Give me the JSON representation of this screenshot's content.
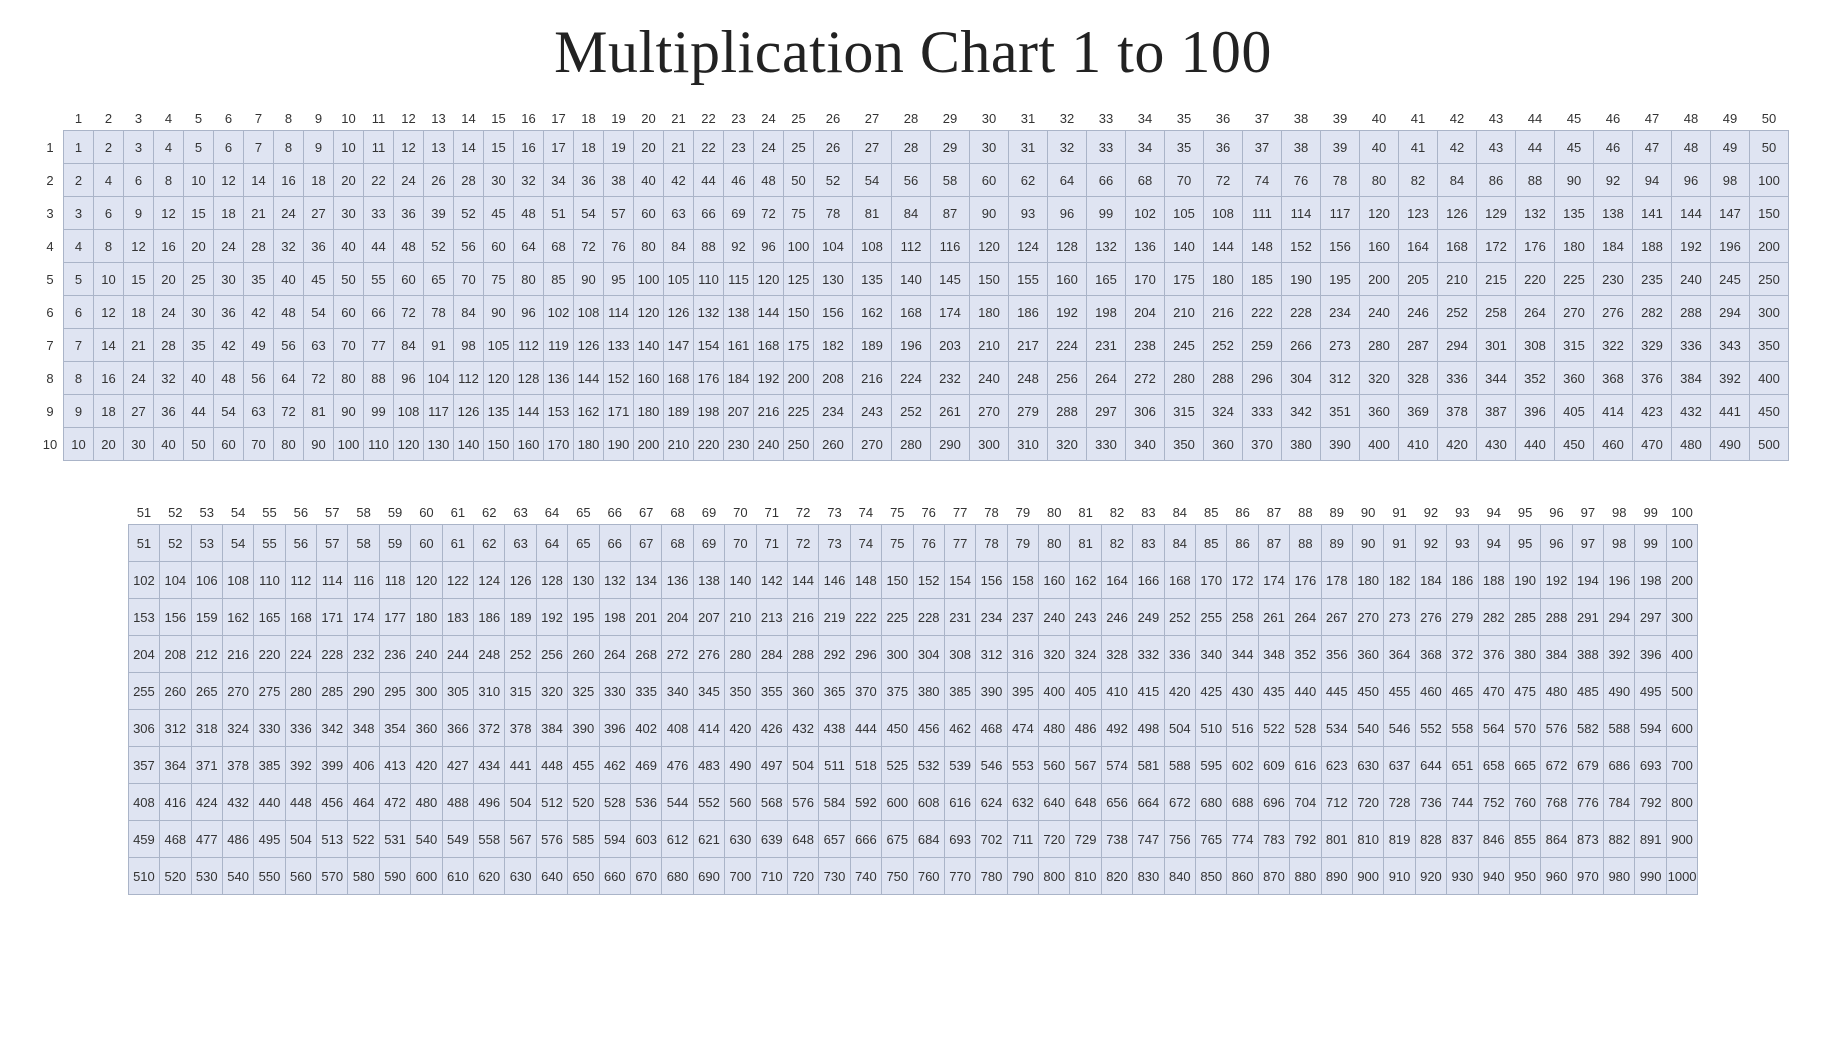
{
  "title": "Multiplication Chart 1 to 100",
  "chart_data": {
    "type": "table",
    "title": "Multiplication Chart 1 to 100",
    "description": "Two sub-tables showing products of rows 1–10 with columns 1–50 and 51–100.",
    "tables": [
      {
        "row_headers": [
          1,
          2,
          3,
          4,
          5,
          6,
          7,
          8,
          9,
          10
        ],
        "col_headers": [
          1,
          2,
          3,
          4,
          5,
          6,
          7,
          8,
          9,
          10,
          11,
          12,
          13,
          14,
          15,
          16,
          17,
          18,
          19,
          20,
          21,
          22,
          23,
          24,
          25,
          26,
          27,
          28,
          29,
          30,
          31,
          32,
          33,
          34,
          35,
          36,
          37,
          38,
          39,
          40,
          41,
          42,
          43,
          44,
          45,
          46,
          47,
          48,
          49,
          50
        ],
        "rows": [
          [
            1,
            2,
            3,
            4,
            5,
            6,
            7,
            8,
            9,
            10,
            11,
            12,
            13,
            14,
            15,
            16,
            17,
            18,
            19,
            20,
            21,
            22,
            23,
            24,
            25,
            26,
            27,
            28,
            29,
            30,
            31,
            32,
            33,
            34,
            35,
            36,
            37,
            38,
            39,
            40,
            41,
            42,
            43,
            44,
            45,
            46,
            47,
            48,
            49,
            50
          ],
          [
            2,
            4,
            6,
            8,
            10,
            12,
            14,
            16,
            18,
            20,
            22,
            24,
            26,
            28,
            30,
            32,
            34,
            36,
            38,
            40,
            42,
            44,
            46,
            48,
            50,
            52,
            54,
            56,
            58,
            60,
            62,
            64,
            66,
            68,
            70,
            72,
            74,
            76,
            78,
            80,
            82,
            84,
            86,
            88,
            90,
            92,
            94,
            96,
            98,
            100
          ],
          [
            3,
            6,
            9,
            12,
            15,
            18,
            21,
            24,
            27,
            30,
            33,
            36,
            39,
            52,
            45,
            48,
            51,
            54,
            57,
            60,
            63,
            66,
            69,
            72,
            75,
            78,
            81,
            84,
            87,
            90,
            93,
            96,
            99,
            102,
            105,
            108,
            111,
            114,
            117,
            120,
            123,
            126,
            129,
            132,
            135,
            138,
            141,
            144,
            147,
            150
          ],
          [
            4,
            8,
            12,
            16,
            20,
            24,
            28,
            32,
            36,
            40,
            44,
            48,
            52,
            56,
            60,
            64,
            68,
            72,
            76,
            80,
            84,
            88,
            92,
            96,
            100,
            104,
            108,
            112,
            116,
            120,
            124,
            128,
            132,
            136,
            140,
            144,
            148,
            152,
            156,
            160,
            164,
            168,
            172,
            176,
            180,
            184,
            188,
            192,
            196,
            200
          ],
          [
            5,
            10,
            15,
            20,
            25,
            30,
            35,
            40,
            45,
            50,
            55,
            60,
            65,
            70,
            75,
            80,
            85,
            90,
            95,
            100,
            105,
            110,
            115,
            120,
            125,
            130,
            135,
            140,
            145,
            150,
            155,
            160,
            165,
            170,
            175,
            180,
            185,
            190,
            195,
            200,
            205,
            210,
            215,
            220,
            225,
            230,
            235,
            240,
            245,
            250
          ],
          [
            6,
            12,
            18,
            24,
            30,
            36,
            42,
            48,
            54,
            60,
            66,
            72,
            78,
            84,
            90,
            96,
            102,
            108,
            114,
            120,
            126,
            132,
            138,
            144,
            150,
            156,
            162,
            168,
            174,
            180,
            186,
            192,
            198,
            204,
            210,
            216,
            222,
            228,
            234,
            240,
            246,
            252,
            258,
            264,
            270,
            276,
            282,
            288,
            294,
            300
          ],
          [
            7,
            14,
            21,
            28,
            35,
            42,
            49,
            56,
            63,
            70,
            77,
            84,
            91,
            98,
            105,
            112,
            119,
            126,
            133,
            140,
            147,
            154,
            161,
            168,
            175,
            182,
            189,
            196,
            203,
            210,
            217,
            224,
            231,
            238,
            245,
            252,
            259,
            266,
            273,
            280,
            287,
            294,
            301,
            308,
            315,
            322,
            329,
            336,
            343,
            350
          ],
          [
            8,
            16,
            24,
            32,
            40,
            48,
            56,
            64,
            72,
            80,
            88,
            96,
            104,
            112,
            120,
            128,
            136,
            144,
            152,
            160,
            168,
            176,
            184,
            192,
            200,
            208,
            216,
            224,
            232,
            240,
            248,
            256,
            264,
            272,
            280,
            288,
            296,
            304,
            312,
            320,
            328,
            336,
            344,
            352,
            360,
            368,
            376,
            384,
            392,
            400
          ],
          [
            9,
            18,
            27,
            36,
            44,
            54,
            63,
            72,
            81,
            90,
            99,
            108,
            117,
            126,
            135,
            144,
            153,
            162,
            171,
            180,
            189,
            198,
            207,
            216,
            225,
            234,
            243,
            252,
            261,
            270,
            279,
            288,
            297,
            306,
            315,
            324,
            333,
            342,
            351,
            360,
            369,
            378,
            387,
            396,
            405,
            414,
            423,
            432,
            441,
            450
          ],
          [
            10,
            20,
            30,
            40,
            50,
            60,
            70,
            80,
            90,
            100,
            110,
            120,
            130,
            140,
            150,
            160,
            170,
            180,
            190,
            200,
            210,
            220,
            230,
            240,
            250,
            260,
            270,
            280,
            290,
            300,
            310,
            320,
            330,
            340,
            350,
            360,
            370,
            380,
            390,
            400,
            410,
            420,
            430,
            440,
            450,
            460,
            470,
            480,
            490,
            500
          ]
        ]
      },
      {
        "col_headers": [
          51,
          52,
          53,
          54,
          55,
          56,
          57,
          58,
          59,
          60,
          61,
          62,
          63,
          64,
          65,
          66,
          67,
          68,
          69,
          70,
          71,
          72,
          73,
          74,
          75,
          76,
          77,
          78,
          79,
          80,
          81,
          82,
          83,
          84,
          85,
          86,
          87,
          88,
          89,
          90,
          91,
          92,
          93,
          94,
          95,
          96,
          97,
          98,
          99,
          100
        ],
        "rows": [
          [
            51,
            52,
            53,
            54,
            55,
            56,
            57,
            58,
            59,
            60,
            61,
            62,
            63,
            64,
            65,
            66,
            67,
            68,
            69,
            70,
            71,
            72,
            73,
            74,
            75,
            76,
            77,
            78,
            79,
            80,
            81,
            82,
            83,
            84,
            85,
            86,
            87,
            88,
            89,
            90,
            91,
            92,
            93,
            94,
            95,
            96,
            97,
            98,
            99,
            100
          ],
          [
            102,
            104,
            106,
            108,
            110,
            112,
            114,
            116,
            118,
            120,
            122,
            124,
            126,
            128,
            130,
            132,
            134,
            136,
            138,
            140,
            142,
            144,
            146,
            148,
            150,
            152,
            154,
            156,
            158,
            160,
            162,
            164,
            166,
            168,
            170,
            172,
            174,
            176,
            178,
            180,
            182,
            184,
            186,
            188,
            190,
            192,
            194,
            196,
            198,
            200
          ],
          [
            153,
            156,
            159,
            162,
            165,
            168,
            171,
            174,
            177,
            180,
            183,
            186,
            189,
            192,
            195,
            198,
            201,
            204,
            207,
            210,
            213,
            216,
            219,
            222,
            225,
            228,
            231,
            234,
            237,
            240,
            243,
            246,
            249,
            252,
            255,
            258,
            261,
            264,
            267,
            270,
            273,
            276,
            279,
            282,
            285,
            288,
            291,
            294,
            297,
            300
          ],
          [
            204,
            208,
            212,
            216,
            220,
            224,
            228,
            232,
            236,
            240,
            244,
            248,
            252,
            256,
            260,
            264,
            268,
            272,
            276,
            280,
            284,
            288,
            292,
            296,
            300,
            304,
            308,
            312,
            316,
            320,
            324,
            328,
            332,
            336,
            340,
            344,
            348,
            352,
            356,
            360,
            364,
            368,
            372,
            376,
            380,
            384,
            388,
            392,
            396,
            400
          ],
          [
            255,
            260,
            265,
            270,
            275,
            280,
            285,
            290,
            295,
            300,
            305,
            310,
            315,
            320,
            325,
            330,
            335,
            340,
            345,
            350,
            355,
            360,
            365,
            370,
            375,
            380,
            385,
            390,
            395,
            400,
            405,
            410,
            415,
            420,
            425,
            430,
            435,
            440,
            445,
            450,
            455,
            460,
            465,
            470,
            475,
            480,
            485,
            490,
            495,
            500
          ],
          [
            306,
            312,
            318,
            324,
            330,
            336,
            342,
            348,
            354,
            360,
            366,
            372,
            378,
            384,
            390,
            396,
            402,
            408,
            414,
            420,
            426,
            432,
            438,
            444,
            450,
            456,
            462,
            468,
            474,
            480,
            486,
            492,
            498,
            504,
            510,
            516,
            522,
            528,
            534,
            540,
            546,
            552,
            558,
            564,
            570,
            576,
            582,
            588,
            594,
            600
          ],
          [
            357,
            364,
            371,
            378,
            385,
            392,
            399,
            406,
            413,
            420,
            427,
            434,
            441,
            448,
            455,
            462,
            469,
            476,
            483,
            490,
            497,
            504,
            511,
            518,
            525,
            532,
            539,
            546,
            553,
            560,
            567,
            574,
            581,
            588,
            595,
            602,
            609,
            616,
            623,
            630,
            637,
            644,
            651,
            658,
            665,
            672,
            679,
            686,
            693,
            700
          ],
          [
            408,
            416,
            424,
            432,
            440,
            448,
            456,
            464,
            472,
            480,
            488,
            496,
            504,
            512,
            520,
            528,
            536,
            544,
            552,
            560,
            568,
            576,
            584,
            592,
            600,
            608,
            616,
            624,
            632,
            640,
            648,
            656,
            664,
            672,
            680,
            688,
            696,
            704,
            712,
            720,
            728,
            736,
            744,
            752,
            760,
            768,
            776,
            784,
            792,
            800
          ],
          [
            459,
            468,
            477,
            486,
            495,
            504,
            513,
            522,
            531,
            540,
            549,
            558,
            567,
            576,
            585,
            594,
            603,
            612,
            621,
            630,
            639,
            648,
            657,
            666,
            675,
            684,
            693,
            702,
            711,
            720,
            729,
            738,
            747,
            756,
            765,
            774,
            783,
            792,
            801,
            810,
            819,
            828,
            837,
            846,
            855,
            864,
            873,
            882,
            891,
            900
          ],
          [
            510,
            520,
            530,
            540,
            550,
            560,
            570,
            580,
            590,
            600,
            610,
            620,
            630,
            640,
            650,
            660,
            670,
            680,
            690,
            700,
            710,
            720,
            730,
            740,
            750,
            760,
            770,
            780,
            790,
            800,
            810,
            820,
            830,
            840,
            850,
            860,
            870,
            880,
            890,
            900,
            910,
            920,
            930,
            940,
            950,
            960,
            970,
            980,
            990,
            1000
          ]
        ]
      }
    ]
  }
}
